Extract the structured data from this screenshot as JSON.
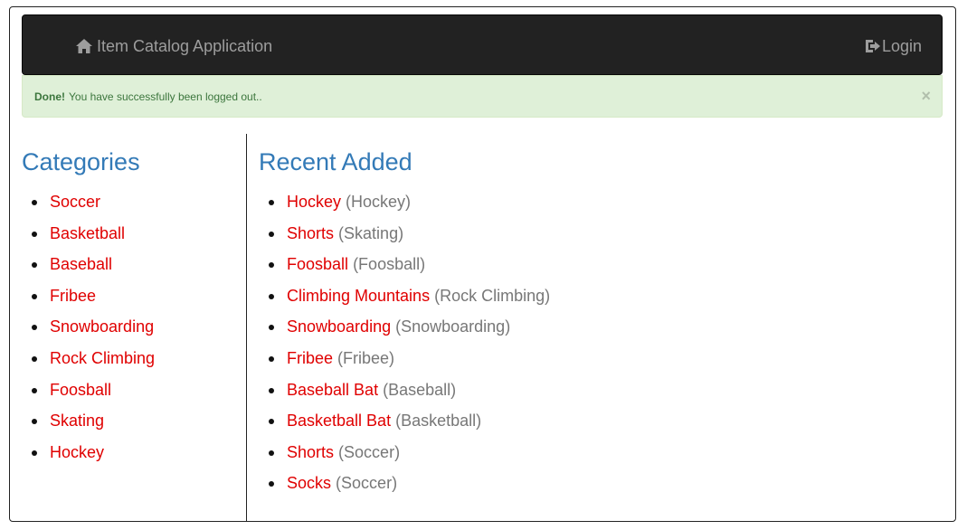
{
  "navbar": {
    "brand_icon": "home-icon",
    "brand_label": "Item Catalog Application",
    "login_icon": "log-in-icon",
    "login_label": "Login"
  },
  "alert": {
    "strong": "Done!",
    "message": "You have successfully been logged out..",
    "close_label": "×"
  },
  "categories": {
    "heading": "Categories",
    "items": [
      "Soccer",
      "Basketball",
      "Baseball",
      "Fribee",
      "Snowboarding",
      "Rock Climbing",
      "Foosball",
      "Skating",
      "Hockey"
    ]
  },
  "recent": {
    "heading": "Recent Added",
    "items": [
      {
        "name": "Hockey",
        "category": "(Hockey)"
      },
      {
        "name": "Shorts",
        "category": "(Skating)"
      },
      {
        "name": "Foosball",
        "category": "(Foosball)"
      },
      {
        "name": "Climbing Mountains",
        "category": "(Rock Climbing)"
      },
      {
        "name": "Snowboarding",
        "category": "(Snowboarding)"
      },
      {
        "name": "Fribee",
        "category": "(Fribee)"
      },
      {
        "name": "Baseball Bat",
        "category": "(Baseball)"
      },
      {
        "name": "Basketball Bat",
        "category": "(Basketball)"
      },
      {
        "name": "Shorts",
        "category": "(Soccer)"
      },
      {
        "name": "Socks",
        "category": "(Soccer)"
      }
    ]
  },
  "colors": {
    "navbar_bg": "#222222",
    "nav_text": "#9d9d9d",
    "heading": "#337ab7",
    "link": "#e00000",
    "muted": "#777777",
    "alert_bg": "#dff0d8",
    "alert_text": "#3c763d"
  }
}
